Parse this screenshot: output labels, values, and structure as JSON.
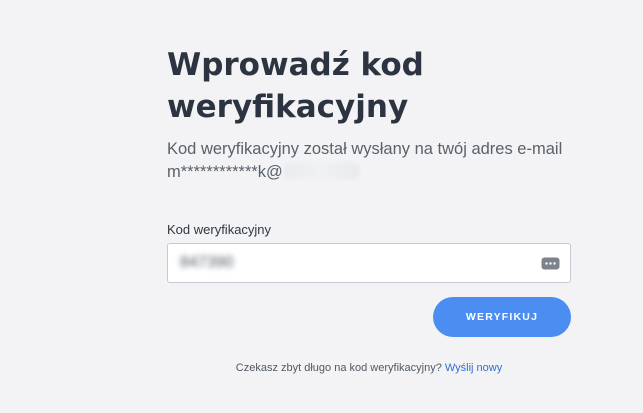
{
  "verification": {
    "title_line_1": "Wprowadź kod",
    "title_line_2": "weryfikacyjny",
    "subtitle_prefix": "Kod weryfikacyjny został wysłany na twój adres e-mail m************k@",
    "field_label": "Kod weryfikacyjny",
    "code_value": "847390",
    "verify_button_label": "WERYFIKUJ",
    "footer_text": "Czekasz zbyt długo na kod weryfikacyjny?",
    "resend_link_label": "Wyślij nowy"
  },
  "colors": {
    "background": "#f3f3f5",
    "title": "#2b3440",
    "subtitle": "#59616b",
    "input_border": "#c6cbd3",
    "button": "#4b8df0",
    "link": "#2c6fd6"
  },
  "icons": {
    "password_key": "key-icon"
  }
}
